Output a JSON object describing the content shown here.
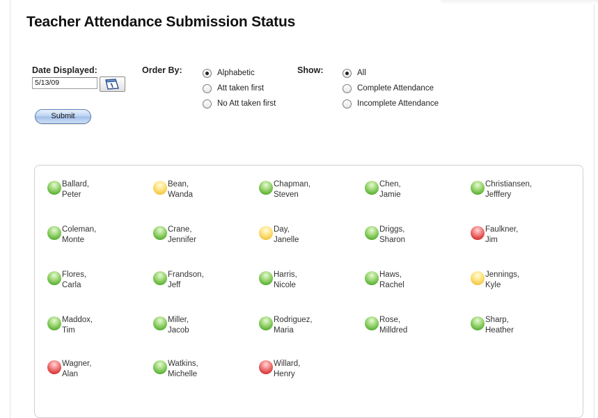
{
  "page": {
    "title": "Teacher Attendance Submission Status"
  },
  "form": {
    "date_label": "Date Displayed:",
    "date_value": "5/13/09",
    "submit_label": "Submit",
    "order_by": {
      "label": "Order By:",
      "options": [
        {
          "label": "Alphabetic",
          "selected": true
        },
        {
          "label": "Att taken first",
          "selected": false
        },
        {
          "label": "No Att taken first",
          "selected": false
        }
      ]
    },
    "show": {
      "label": "Show:",
      "options": [
        {
          "label": "All",
          "selected": true
        },
        {
          "label": "Complete Attendance",
          "selected": false
        },
        {
          "label": "Incomplete Attendance",
          "selected": false
        }
      ]
    }
  },
  "status_colors": {
    "green": "#5fb338",
    "yellow": "#f3c94a",
    "red": "#d83a3a"
  },
  "teachers": [
    {
      "last": "Ballard,",
      "first": "Peter",
      "status": "green"
    },
    {
      "last": "Bean,",
      "first": "Wanda",
      "status": "yellow"
    },
    {
      "last": "Chapman,",
      "first": "Steven",
      "status": "green"
    },
    {
      "last": "Chen,",
      "first": "Jamie",
      "status": "green"
    },
    {
      "last": "Christiansen,",
      "first": "Jefffery",
      "status": "green"
    },
    {
      "last": "Coleman,",
      "first": "Monte",
      "status": "green"
    },
    {
      "last": "Crane,",
      "first": "Jennifer",
      "status": "green"
    },
    {
      "last": "Day,",
      "first": "Janelle",
      "status": "yellow"
    },
    {
      "last": "Driggs,",
      "first": "Sharon",
      "status": "green"
    },
    {
      "last": "Faulkner,",
      "first": "Jim",
      "status": "red"
    },
    {
      "last": "Flores,",
      "first": "Carla",
      "status": "green"
    },
    {
      "last": "Frandson,",
      "first": "Jeff",
      "status": "green"
    },
    {
      "last": "Harris,",
      "first": "Nicole",
      "status": "green"
    },
    {
      "last": "Haws,",
      "first": "Rachel",
      "status": "green"
    },
    {
      "last": "Jennings,",
      "first": "Kyle",
      "status": "yellow"
    },
    {
      "last": "Maddox,",
      "first": "Tim",
      "status": "green"
    },
    {
      "last": "Miller,",
      "first": "Jacob",
      "status": "green"
    },
    {
      "last": "Rodriguez,",
      "first": "Maria",
      "status": "green"
    },
    {
      "last": "Rose,",
      "first": "Milldred",
      "status": "green"
    },
    {
      "last": "Sharp,",
      "first": "Heather",
      "status": "green"
    },
    {
      "last": "Wagner,",
      "first": "Alan",
      "status": "red"
    },
    {
      "last": "Watkins,",
      "first": "Michelle",
      "status": "green"
    },
    {
      "last": "Willard,",
      "first": "Henry",
      "status": "red"
    }
  ]
}
